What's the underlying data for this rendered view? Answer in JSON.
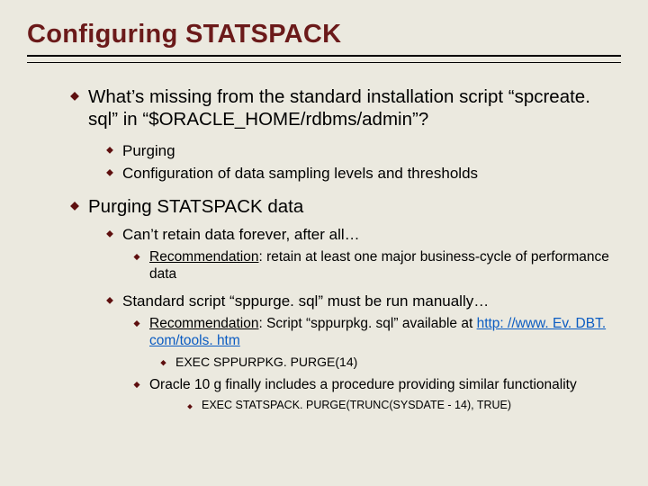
{
  "title": "Configuring STATSPACK",
  "p1": "What’s missing from the standard installation script “spcreate. sql” in “$ORACLE_HOME/rdbms/admin”?",
  "p1a": "Purging",
  "p1b": "Configuration of data sampling levels and thresholds",
  "p2": "Purging STATSPACK data",
  "p2a": "Can’t retain data forever, after all…",
  "rec_label": "Recommendation",
  "p2a1_rest": ":  retain at least one major business-cycle of performance data",
  "p2b": "Standard script “sppurge. sql” must be run manually…",
  "p2b1_rest": ": Script “sppurpkg. sql” available at ",
  "p2b1_url": "http: //www. Ev. DBT. com/tools. htm",
  "p2b1a": "EXEC SPPURPKG. PURGE(14)",
  "p2b2": "Oracle 10 g finally includes a procedure providing similar functionality",
  "p2b2a": "EXEC STATSPACK. PURGE(TRUNC(SYSDATE - 14), TRUE)"
}
